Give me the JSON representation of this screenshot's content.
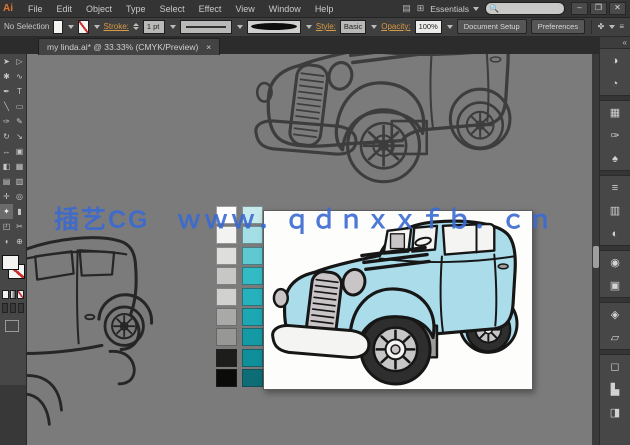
{
  "palette": {
    "brand": "#e0762f",
    "pasteboard": "#7b7b7b",
    "wm": "#3b6ad2",
    "carbody": "#abdcea"
  },
  "menubar": {
    "logo": "Ai",
    "items": [
      {
        "name": "menu-file",
        "label": "File"
      },
      {
        "name": "menu-edit",
        "label": "Edit"
      },
      {
        "name": "menu-object",
        "label": "Object"
      },
      {
        "name": "menu-type",
        "label": "Type"
      },
      {
        "name": "menu-select",
        "label": "Select"
      },
      {
        "name": "menu-effect",
        "label": "Effect"
      },
      {
        "name": "menu-view",
        "label": "View"
      },
      {
        "name": "menu-window",
        "label": "Window"
      },
      {
        "name": "menu-help",
        "label": "Help"
      }
    ],
    "bridge_icon": "▤",
    "arrange_icon": "⊞",
    "workspace": "Essentials",
    "window_controls": [
      {
        "name": "minimize-button",
        "glyph": "–"
      },
      {
        "name": "restore-button",
        "glyph": "❐"
      },
      {
        "name": "close-button",
        "glyph": "✕"
      }
    ]
  },
  "controlbar": {
    "selection_status": "No Selection",
    "stroke_label": "Stroke:",
    "stroke_value": "1 pt",
    "style_label": "Style:",
    "style_value": "Basic",
    "opacity_label": "Opacity:",
    "opacity_value": "100%",
    "buttons": [
      {
        "name": "document-setup-button",
        "label": "Document Setup"
      },
      {
        "name": "preferences-button",
        "label": "Preferences"
      }
    ],
    "align_icon": "✤",
    "panel_icon": "≡"
  },
  "tabbar": {
    "title": "my linda.ai* @ 33.33% (CMYK/Preview)",
    "close_glyph": "×"
  },
  "toolbar": {
    "tools": [
      {
        "name": "selection-tool",
        "glyph": "➤"
      },
      {
        "name": "direct-selection-tool",
        "glyph": "▷"
      },
      {
        "name": "magic-wand-tool",
        "glyph": "✱"
      },
      {
        "name": "lasso-tool",
        "glyph": "∿"
      },
      {
        "name": "pen-tool",
        "glyph": "✒"
      },
      {
        "name": "type-tool",
        "glyph": "T"
      },
      {
        "name": "line-segment-tool",
        "glyph": "╲"
      },
      {
        "name": "rectangle-tool",
        "glyph": "▭"
      },
      {
        "name": "paintbrush-tool",
        "glyph": "✑"
      },
      {
        "name": "pencil-tool",
        "glyph": "✎"
      },
      {
        "name": "rotate-tool",
        "glyph": "↻"
      },
      {
        "name": "scale-tool",
        "glyph": "↘"
      },
      {
        "name": "width-tool",
        "glyph": "↔"
      },
      {
        "name": "free-transform-tool",
        "glyph": "▣"
      },
      {
        "name": "shape-builder-tool",
        "glyph": "◧"
      },
      {
        "name": "perspective-grid-tool",
        "glyph": "▦"
      },
      {
        "name": "mesh-tool",
        "glyph": "▤"
      },
      {
        "name": "gradient-tool",
        "glyph": "▥"
      },
      {
        "name": "eyedropper-tool",
        "glyph": "✛"
      },
      {
        "name": "blend-tool",
        "glyph": "◎"
      },
      {
        "name": "symbol-sprayer-tool",
        "glyph": "✦",
        "active": true
      },
      {
        "name": "column-graph-tool",
        "glyph": "▮"
      },
      {
        "name": "artboard-tool",
        "glyph": "◰"
      },
      {
        "name": "slice-tool",
        "glyph": "✂"
      },
      {
        "name": "hand-tool",
        "glyph": "◖"
      },
      {
        "name": "zoom-tool",
        "glyph": "⊕"
      }
    ]
  },
  "dock": {
    "collapse_glyph": "«",
    "panels": [
      {
        "name": "panel-color",
        "glyph": "◑"
      },
      {
        "name": "panel-color-guide",
        "glyph": "◔"
      },
      {
        "sep": true
      },
      {
        "name": "panel-swatches",
        "glyph": "▦"
      },
      {
        "name": "panel-brushes",
        "glyph": "✑"
      },
      {
        "name": "panel-symbols",
        "glyph": "♠"
      },
      {
        "sep": true
      },
      {
        "name": "panel-stroke",
        "glyph": "≡"
      },
      {
        "name": "panel-gradient",
        "glyph": "▥"
      },
      {
        "name": "panel-transparency",
        "glyph": "◐"
      },
      {
        "sep": true
      },
      {
        "name": "panel-appearance",
        "glyph": "◉"
      },
      {
        "name": "panel-graphic-styles",
        "glyph": "▣"
      },
      {
        "sep": true
      },
      {
        "name": "panel-layers",
        "glyph": "◈"
      },
      {
        "name": "panel-artboards",
        "glyph": "▱"
      },
      {
        "sep": true
      },
      {
        "name": "panel-transform",
        "glyph": "◻"
      },
      {
        "name": "panel-align",
        "glyph": "▙"
      },
      {
        "name": "panel-pathfinder",
        "glyph": "◨"
      }
    ]
  },
  "canvas": {
    "watermark_text": "插艺CG　ｗｗｗ．ｑｄｎｘｘｆｂ．ｃｎ",
    "swatches_gray": [
      {
        "name": "swatch-gray-1",
        "color": "#ffffff"
      },
      {
        "name": "swatch-gray-2",
        "color": "#f3f3f1"
      },
      {
        "name": "swatch-gray-3",
        "color": "#dededc"
      },
      {
        "name": "swatch-gray-4",
        "color": "#c7c7c5"
      },
      {
        "name": "swatch-gray-5",
        "color": "#d1d1cf"
      },
      {
        "name": "swatch-gray-6",
        "color": "#a9a9a7"
      },
      {
        "name": "swatch-gray-7",
        "color": "#979795"
      },
      {
        "name": "swatch-gray-8",
        "color": "#1d1d1b"
      },
      {
        "name": "swatch-gray-9",
        "color": "#0b0b09"
      }
    ],
    "swatches_teal": [
      {
        "name": "swatch-teal-1",
        "color": "#c6e9ec"
      },
      {
        "name": "swatch-teal-2",
        "color": "#a3dfe5"
      },
      {
        "name": "swatch-teal-3",
        "color": "#5fc9d1"
      },
      {
        "name": "swatch-teal-4",
        "color": "#33bbc5"
      },
      {
        "name": "swatch-teal-5",
        "color": "#27b1bc"
      },
      {
        "name": "swatch-teal-6",
        "color": "#1da7b2"
      },
      {
        "name": "swatch-teal-7",
        "color": "#149aa5"
      },
      {
        "name": "swatch-teal-8",
        "color": "#0e8f9a"
      },
      {
        "name": "swatch-teal-9",
        "color": "#0c6d77"
      }
    ]
  }
}
